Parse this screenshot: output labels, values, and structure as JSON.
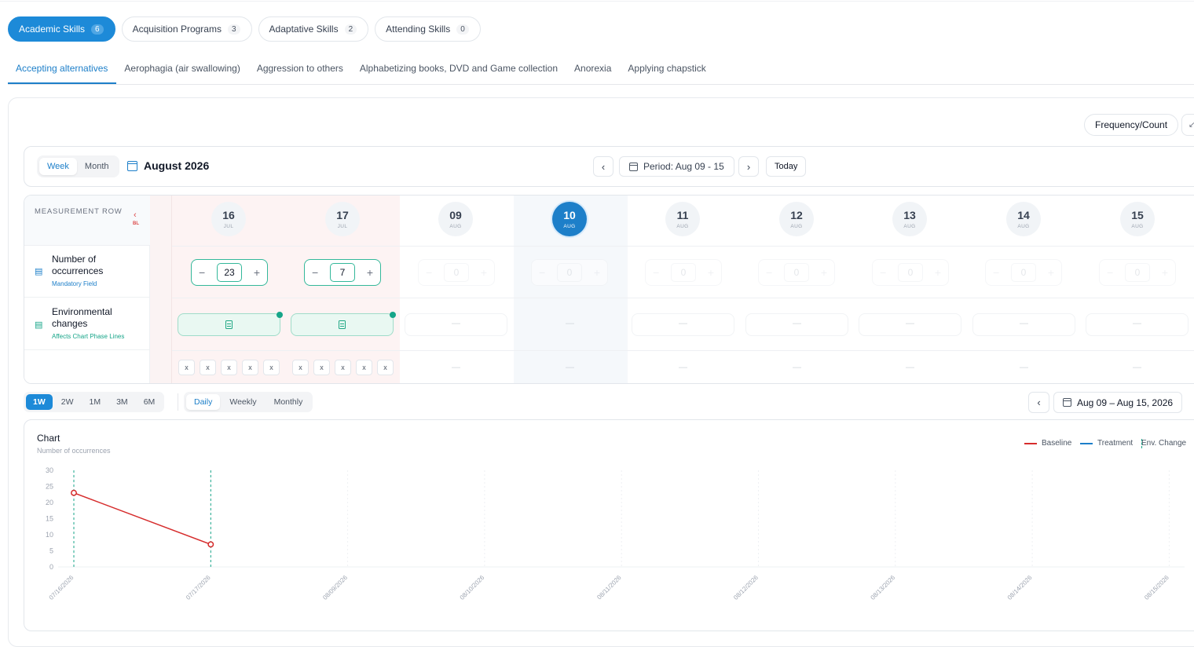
{
  "skill_tabs": [
    {
      "label": "Academic Skills",
      "count": "6"
    },
    {
      "label": "Acquisition Programs",
      "count": "3"
    },
    {
      "label": "Adaptative Skills",
      "count": "2"
    },
    {
      "label": "Attending Skills",
      "count": "0"
    }
  ],
  "behavior_tabs": [
    "Accepting alternatives",
    "Aerophagia (air swallowing)",
    "Aggression to others",
    "Alphabetizing books, DVD and Game collection",
    "Anorexia",
    "Applying chapstick"
  ],
  "toolbar": {
    "measure_type": "Frequency/Count",
    "expand_icon": "collapse-arrows-icon",
    "view_week": "Week",
    "view_month": "Month",
    "month_title": "August 2026",
    "period": "Period: Aug 09 - 15",
    "today": "Today"
  },
  "grid": {
    "header_label": "MEASUREMENT ROW",
    "baseline_tag": "BL",
    "rows": [
      {
        "name": "Number of occurrences",
        "sub": "Mandatory Field",
        "icon": "bar-chart-icon"
      },
      {
        "name": "Environmental changes",
        "sub": "Affects Chart Phase Lines",
        "icon": "document-icon"
      }
    ],
    "dates": [
      {
        "day": "16",
        "month": "JUL"
      },
      {
        "day": "17",
        "month": "JUL"
      },
      {
        "day": "09",
        "month": "AUG"
      },
      {
        "day": "10",
        "month": "AUG"
      },
      {
        "day": "11",
        "month": "AUG"
      },
      {
        "day": "12",
        "month": "AUG"
      },
      {
        "day": "13",
        "month": "AUG"
      },
      {
        "day": "14",
        "month": "AUG"
      },
      {
        "day": "15",
        "month": "AUG"
      }
    ],
    "occurrences": [
      "23",
      "7",
      "0",
      "0",
      "0",
      "0",
      "0",
      "0",
      "0"
    ],
    "empty_mark": "—",
    "x_mark": "x"
  },
  "chart_controls": {
    "ranges": [
      "1W",
      "2W",
      "1M",
      "3M",
      "6M"
    ],
    "granularity": [
      "Daily",
      "Weekly",
      "Monthly"
    ],
    "date_range": "Aug 09 – Aug 15, 2026"
  },
  "chart_data": {
    "type": "line",
    "title": "Chart",
    "subtitle": "Number of occurrences",
    "x": [
      "07/16/2026",
      "07/17/2026",
      "08/09/2026",
      "08/10/2026",
      "08/11/2026",
      "08/12/2026",
      "08/13/2026",
      "08/14/2026",
      "08/15/2026"
    ],
    "series": [
      {
        "name": "Baseline",
        "color": "#d62c2c",
        "values": [
          23,
          7,
          null,
          null,
          null,
          null,
          null,
          null,
          null
        ]
      },
      {
        "name": "Treatment",
        "color": "#1d7fc9",
        "values": [
          null,
          null,
          null,
          null,
          null,
          null,
          null,
          null,
          null
        ]
      }
    ],
    "phase_lines": {
      "name": "Env. Change",
      "color": "#17a589",
      "at": [
        "07/16/2026",
        "07/17/2026"
      ]
    },
    "ylim": [
      0,
      30
    ],
    "yticks": [
      0,
      5,
      10,
      15,
      20,
      25,
      30
    ],
    "legend": "top-right",
    "grid": true
  },
  "colors": {
    "accent": "#1d8ad8",
    "baseline_bg": "#fdf2f2",
    "teal": "#17a589",
    "baseline_line": "#d62c2c"
  }
}
